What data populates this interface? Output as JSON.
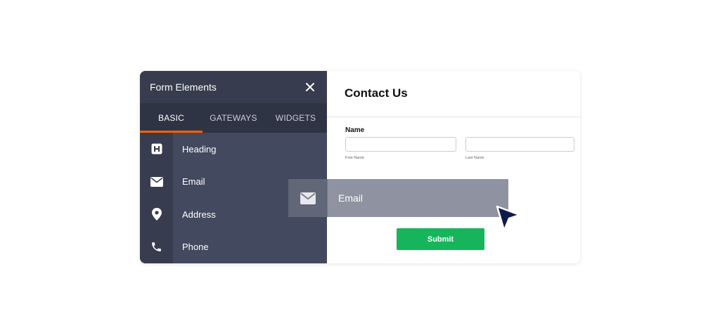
{
  "panel": {
    "title": "Form Elements",
    "close_icon": "close-icon",
    "tabs": [
      {
        "label": "BASIC",
        "active": true
      },
      {
        "label": "GATEWAYS",
        "active": false
      },
      {
        "label": "WIDGETS",
        "active": false
      }
    ],
    "items": [
      {
        "label": "Heading",
        "icon": "heading-icon"
      },
      {
        "label": "Email",
        "icon": "envelope-icon"
      },
      {
        "label": "Address",
        "icon": "map-pin-icon"
      },
      {
        "label": "Phone",
        "icon": "phone-icon"
      }
    ]
  },
  "form": {
    "title": "Contact Us",
    "name_label": "Name",
    "first_name_sublabel": "First Name",
    "last_name_sublabel": "Last Name",
    "submit_label": "Submit"
  },
  "drag_ghost": {
    "label": "Email",
    "icon": "envelope-icon"
  },
  "colors": {
    "accent_tab": "#ff6100",
    "submit": "#17b55b",
    "panel": "#434a5f"
  }
}
